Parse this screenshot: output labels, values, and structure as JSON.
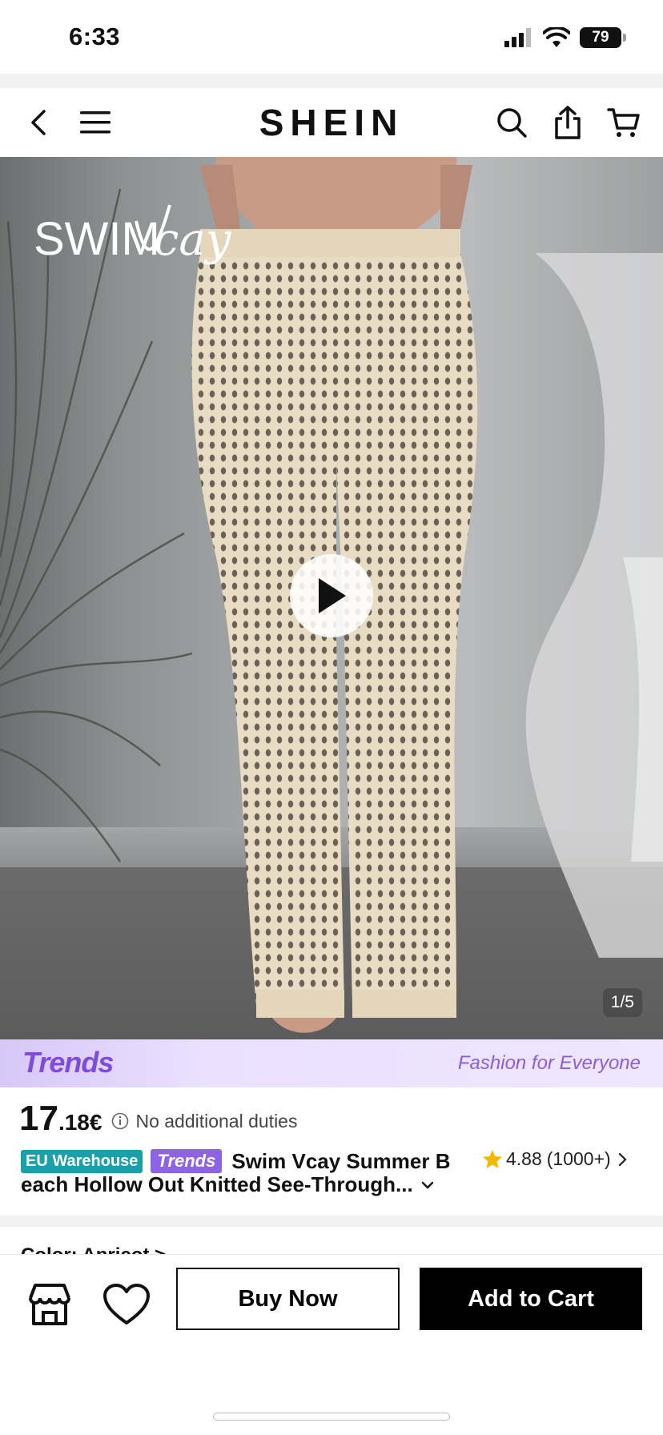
{
  "status_bar": {
    "time": "6:33",
    "battery": "79"
  },
  "header": {
    "logo": "SHEIN"
  },
  "hero": {
    "brand_logo": "SWIMVcay",
    "page_indicator": "1/5"
  },
  "trends_band": {
    "logo": "Trends",
    "slogan": "Fashion for Everyone"
  },
  "product": {
    "price_integer": "17",
    "price_decimal": ".18€",
    "duties_text": "No additional duties",
    "badge_warehouse": "EU Warehouse",
    "badge_trends": "Trends",
    "title_line1": "Swim Vcay Summer B",
    "title_line2": "each Hollow Out Knitted See-Through...",
    "rating": "4.88",
    "reviews": "(1000+)"
  },
  "peek": {
    "text": "Color: Apricot >"
  },
  "bottom_bar": {
    "buy_now": "Buy Now",
    "add_to_cart": "Add to Cart"
  },
  "colors": {
    "accent_purple": "#8f63e6",
    "warehouse_teal": "#1aa0a8",
    "star": "#f5b800"
  }
}
